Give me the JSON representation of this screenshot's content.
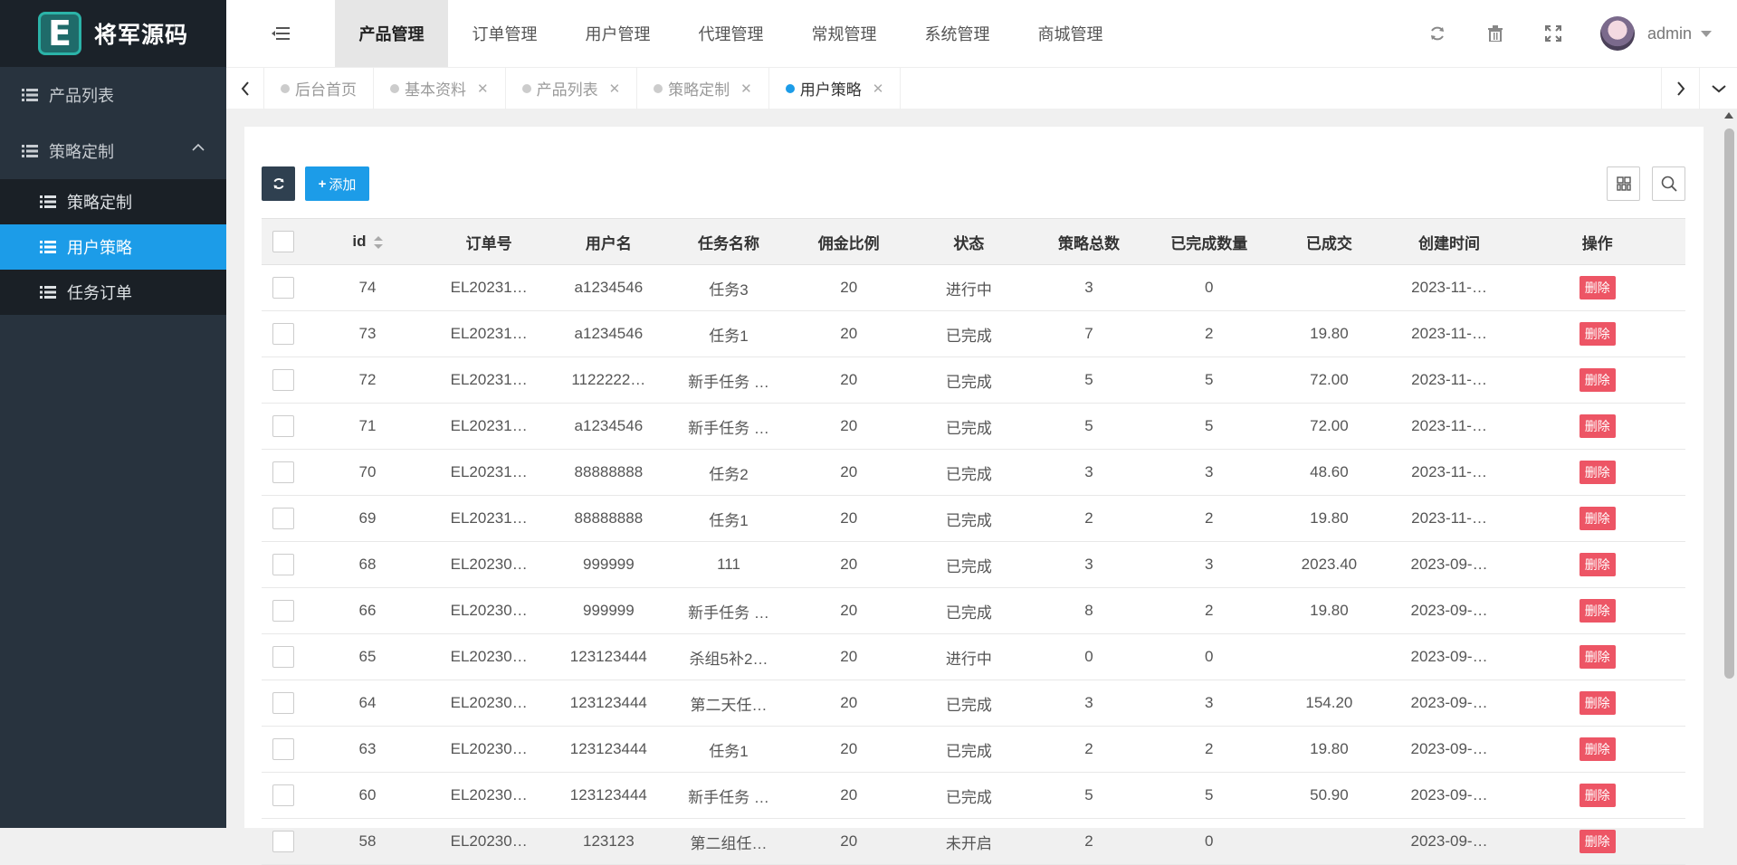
{
  "app": {
    "logo_letter": "E",
    "logo_text": "将军源码",
    "accent": "#1c9ce8"
  },
  "sidebar": {
    "items": [
      {
        "label": "产品列表"
      },
      {
        "label": "策略定制"
      }
    ],
    "sub_items": [
      {
        "label": "策略定制"
      },
      {
        "label": "用户策略"
      },
      {
        "label": "任务订单"
      }
    ]
  },
  "header": {
    "nav": [
      "产品管理",
      "订单管理",
      "用户管理",
      "代理管理",
      "常规管理",
      "系统管理",
      "商城管理"
    ],
    "user": "admin"
  },
  "tabs": [
    "后台首页",
    "基本资料",
    "产品列表",
    "策略定制",
    "用户策略"
  ],
  "toolbar": {
    "add_label": "添加"
  },
  "table": {
    "columns": [
      "id",
      "订单号",
      "用户名",
      "任务名称",
      "佣金比例",
      "状态",
      "策略总数",
      "已完成数量",
      "已成交",
      "创建时间",
      "操作"
    ],
    "delete_label": "删除",
    "rows": [
      [
        "74",
        "EL20231…",
        "a1234546",
        "任务3",
        "20",
        "进行中",
        "3",
        "0",
        "",
        "2023-11-…"
      ],
      [
        "73",
        "EL20231…",
        "a1234546",
        "任务1",
        "20",
        "已完成",
        "7",
        "2",
        "19.80",
        "2023-11-…"
      ],
      [
        "72",
        "EL20231…",
        "1122222…",
        "新手任务 …",
        "20",
        "已完成",
        "5",
        "5",
        "72.00",
        "2023-11-…"
      ],
      [
        "71",
        "EL20231…",
        "a1234546",
        "新手任务 …",
        "20",
        "已完成",
        "5",
        "5",
        "72.00",
        "2023-11-…"
      ],
      [
        "70",
        "EL20231…",
        "88888888",
        "任务2",
        "20",
        "已完成",
        "3",
        "3",
        "48.60",
        "2023-11-…"
      ],
      [
        "69",
        "EL20231…",
        "88888888",
        "任务1",
        "20",
        "已完成",
        "2",
        "2",
        "19.80",
        "2023-11-…"
      ],
      [
        "68",
        "EL20230…",
        "999999",
        "111",
        "20",
        "已完成",
        "3",
        "3",
        "2023.40",
        "2023-09-…"
      ],
      [
        "66",
        "EL20230…",
        "999999",
        "新手任务 …",
        "20",
        "已完成",
        "8",
        "2",
        "19.80",
        "2023-09-…"
      ],
      [
        "65",
        "EL20230…",
        "123123444",
        "杀组5补2…",
        "20",
        "进行中",
        "0",
        "0",
        "",
        "2023-09-…"
      ],
      [
        "64",
        "EL20230…",
        "123123444",
        "第二天任…",
        "20",
        "已完成",
        "3",
        "3",
        "154.20",
        "2023-09-…"
      ],
      [
        "63",
        "EL20230…",
        "123123444",
        "任务1",
        "20",
        "已完成",
        "2",
        "2",
        "19.80",
        "2023-09-…"
      ],
      [
        "60",
        "EL20230…",
        "123123444",
        "新手任务 …",
        "20",
        "已完成",
        "5",
        "5",
        "50.90",
        "2023-09-…"
      ],
      [
        "58",
        "EL20230…",
        "123123",
        "第二组任…",
        "20",
        "未开启",
        "2",
        "0",
        "",
        "2023-09-…"
      ]
    ]
  }
}
